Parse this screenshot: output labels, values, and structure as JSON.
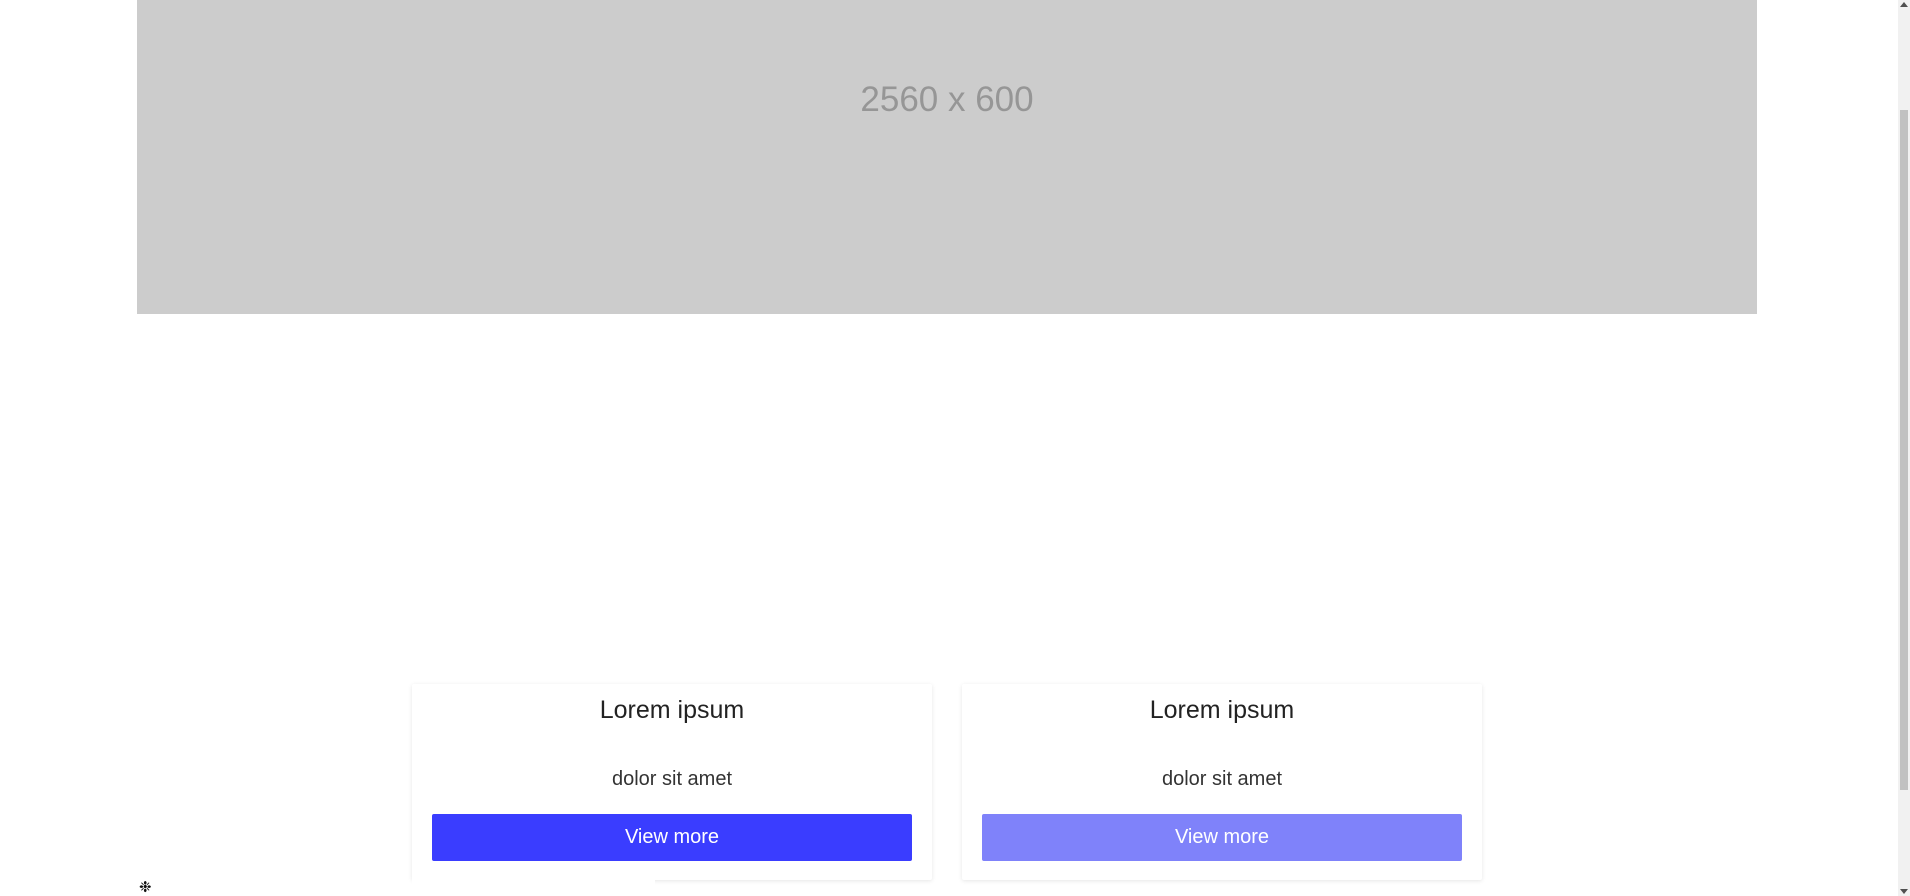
{
  "hero": {
    "placeholder_text": "2560 x 600"
  },
  "cards": [
    {
      "title": "Lorem ipsum",
      "text": "dolor sit amet",
      "button_label": "View more"
    },
    {
      "title": "Lorem ipsum",
      "text": "dolor sit amet",
      "button_label": "View more"
    }
  ],
  "icons": {
    "corner": "snowflake-icon"
  },
  "colors": {
    "hero_bg": "#cccccc",
    "hero_text": "#969696",
    "button_primary": "#3a3dff",
    "button_light": "#7f82fa"
  }
}
